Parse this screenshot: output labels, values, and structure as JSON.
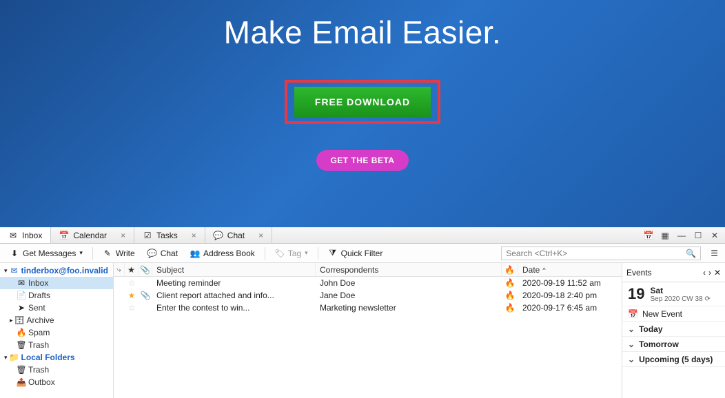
{
  "hero": {
    "title": "Make Email Easier.",
    "download_label": "FREE DOWNLOAD",
    "beta_label": "GET THE BETA"
  },
  "tabs": [
    {
      "label": "Inbox",
      "icon": "mail",
      "closable": false
    },
    {
      "label": "Calendar",
      "icon": "calendar",
      "closable": true
    },
    {
      "label": "Tasks",
      "icon": "tasks",
      "closable": true
    },
    {
      "label": "Chat",
      "icon": "chat",
      "closable": true
    }
  ],
  "toolbar": {
    "get_messages": "Get Messages",
    "write": "Write",
    "chat": "Chat",
    "address_book": "Address Book",
    "tag": "Tag",
    "quick_filter": "Quick Filter",
    "search_placeholder": "Search <Ctrl+K>"
  },
  "sidebar": {
    "account": "tinderbox@foo.invalid",
    "items": [
      "Inbox",
      "Drafts",
      "Sent",
      "Archive",
      "Spam",
      "Trash"
    ],
    "local_folders": "Local Folders",
    "local_items": [
      "Trash",
      "Outbox"
    ]
  },
  "columns": {
    "subject": "Subject",
    "correspondents": "Correspondents",
    "date": "Date"
  },
  "messages": [
    {
      "starred": false,
      "attach": false,
      "subject": "Meeting reminder",
      "correspondent": "John Doe",
      "hot": false,
      "date": "2020-09-19 11:52 am"
    },
    {
      "starred": true,
      "attach": true,
      "subject": "Client report attached and info...",
      "correspondent": "Jane Doe",
      "hot": false,
      "date": "2020-09-18 2:40 pm"
    },
    {
      "starred": false,
      "attach": false,
      "subject": "Enter the contest to win...",
      "correspondent": "Marketing newsletter",
      "hot": true,
      "date": "2020-09-17 6:45 am"
    }
  ],
  "events": {
    "title": "Events",
    "day_num": "19",
    "day_name": "Sat",
    "day_sub": "Sep 2020 CW 38",
    "new_event": "New Event",
    "sections": [
      "Today",
      "Tomorrow",
      "Upcoming (5 days)"
    ]
  }
}
